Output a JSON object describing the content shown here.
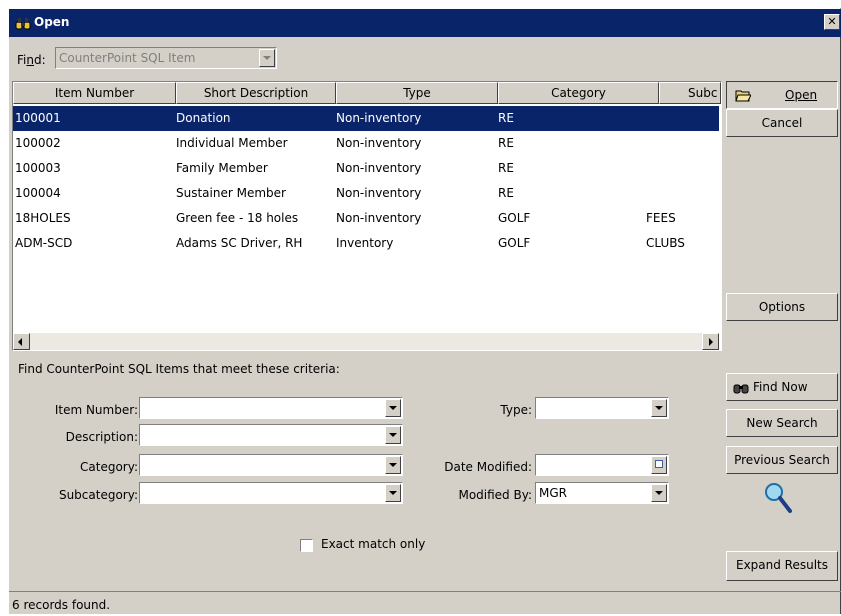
{
  "window": {
    "title": "Open",
    "close_label": "✕"
  },
  "find": {
    "label": "Find:",
    "value": "CounterPoint SQL Item"
  },
  "grid": {
    "columns": [
      "Item Number",
      "Short Description",
      "Type",
      "Category",
      "Subc"
    ],
    "rows": [
      [
        "100001",
        "Donation",
        "Non-inventory",
        "RE",
        ""
      ],
      [
        "100002",
        "Individual Member",
        "Non-inventory",
        "RE",
        ""
      ],
      [
        "100003",
        "Family Member",
        "Non-inventory",
        "RE",
        ""
      ],
      [
        "100004",
        "Sustainer Member",
        "Non-inventory",
        "RE",
        ""
      ],
      [
        "18HOLES",
        "Green fee - 18 holes",
        "Non-inventory",
        "GOLF",
        "FEES"
      ],
      [
        "ADM-SCD",
        "Adams SC Driver, RH",
        "Inventory",
        "GOLF",
        "CLUBS"
      ]
    ],
    "selected_row": 0
  },
  "buttons": {
    "open": "Open",
    "cancel": "Cancel",
    "options": "Options",
    "find_now": "Find Now",
    "new_search": "New Search",
    "previous_search": "Previous Search",
    "expand_results": "Expand Results"
  },
  "criteria": {
    "heading": "Find CounterPoint SQL Items that meet these criteria:",
    "item_number_label": "Item Number:",
    "item_number_value": "",
    "description_label": "Description:",
    "description_value": "",
    "category_label": "Category:",
    "category_value": "",
    "subcategory_label": "Subcategory:",
    "subcategory_value": "",
    "type_label": "Type:",
    "type_value": "",
    "date_modified_label": "Date Modified:",
    "date_modified_value": "",
    "modified_by_label": "Modified By:",
    "modified_by_value": "MGR",
    "exact_match_label": "Exact match only",
    "exact_match_checked": false
  },
  "status": {
    "text": "6 records found."
  },
  "colors": {
    "title_bar": "#0a246a",
    "selection": "#0a246a",
    "face": "#d4d0c8"
  }
}
